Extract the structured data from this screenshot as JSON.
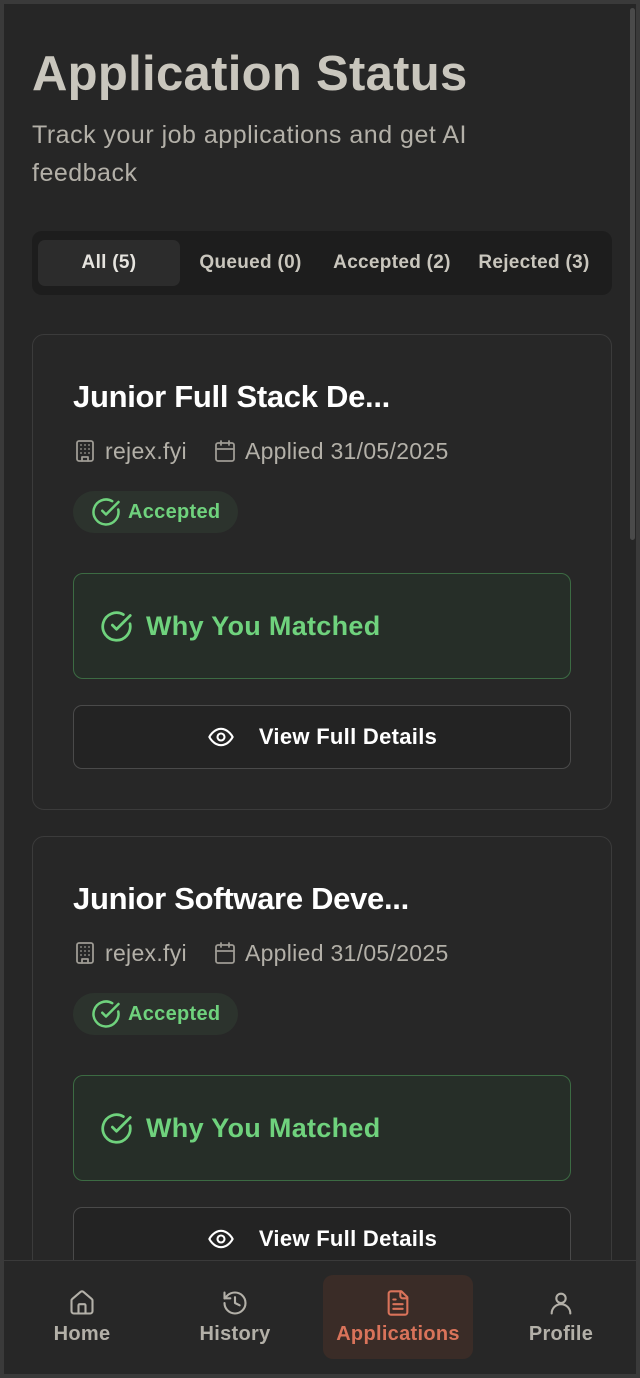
{
  "header": {
    "title": "Application Status",
    "subtitle": "Track your job applications and get AI feedback"
  },
  "tabs": [
    {
      "label": "All (5)",
      "active": true
    },
    {
      "label": "Queued (0)",
      "active": false
    },
    {
      "label": "Accepted (2)",
      "active": false
    },
    {
      "label": "Rejected (3)",
      "active": false
    }
  ],
  "applications": [
    {
      "title": "Junior Full Stack De...",
      "company": "rejex.fyi",
      "applied": "Applied 31/05/2025",
      "status": "Accepted",
      "match_label": "Why You Matched",
      "details_label": "View Full Details"
    },
    {
      "title": "Junior Software Deve...",
      "company": "rejex.fyi",
      "applied": "Applied 31/05/2025",
      "status": "Accepted",
      "match_label": "Why You Matched",
      "details_label": "View Full Details"
    }
  ],
  "bottom_nav": [
    {
      "label": "Home",
      "icon": "home-icon",
      "active": false
    },
    {
      "label": "History",
      "icon": "history-icon",
      "active": false
    },
    {
      "label": "Applications",
      "icon": "document-icon",
      "active": true
    },
    {
      "label": "Profile",
      "icon": "user-icon",
      "active": false
    }
  ],
  "colors": {
    "background": "#262626",
    "accent": "#d9735a",
    "success": "#6fd27d",
    "title": "#c9c6bd"
  },
  "icons": {
    "company": "building-icon",
    "date": "calendar-icon",
    "status": "check-circle-icon",
    "details": "eye-icon"
  }
}
